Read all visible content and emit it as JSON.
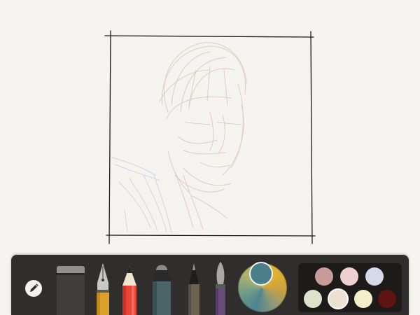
{
  "icons": {
    "settings": "pencil-icon",
    "tools": [
      "eraser-icon",
      "fountain-pen-icon",
      "pencil-icon",
      "marker-icon",
      "fine-pen-icon",
      "brush-icon"
    ],
    "mixer": "color-mixer-icon"
  },
  "colors": {
    "canvas_background": "#f4f3ef",
    "toolbar_background": "#2f2e2c",
    "palette_background": "#1c1b1a",
    "current_color": "#4a7f8a",
    "sketch_stroke": "#d8cbbd",
    "frame_stroke": "#1a1a1a"
  },
  "palette": {
    "selected_index": 5,
    "swatches": [
      "#c79b98",
      "#eed0d0",
      "#d5d9ea",
      "#dde2cc",
      "#ede0d3",
      "#f3efc8",
      "#5e1410"
    ]
  }
}
